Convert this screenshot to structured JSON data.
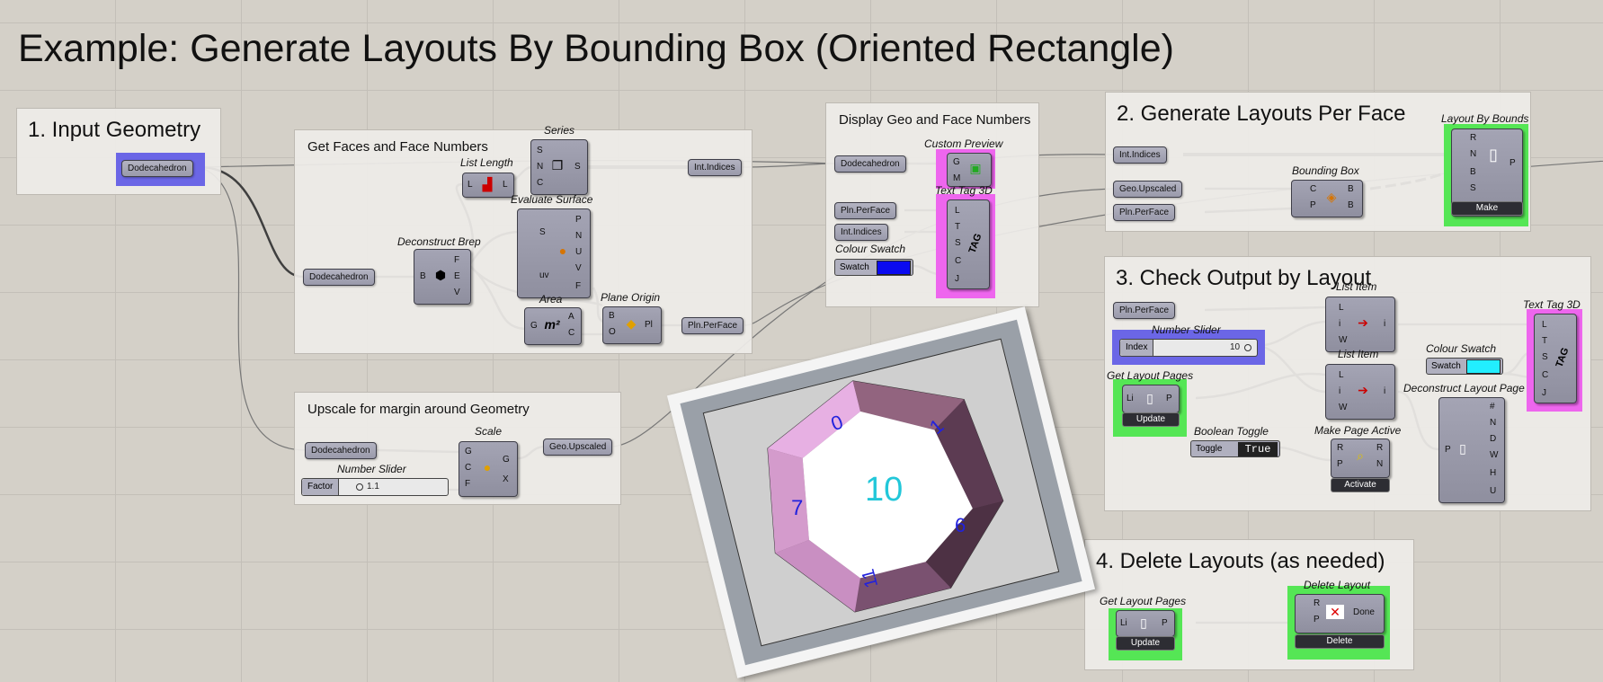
{
  "title": "Example: Generate Layouts By Bounding Box (Oriented Rectangle)",
  "groups": {
    "input": "1. Input Geometry",
    "faces": "Get Faces and Face Numbers",
    "upscale": "Upscale for margin around Geometry",
    "display": "Display Geo and Face Numbers",
    "generate": "2. Generate Layouts Per Face",
    "check": "3. Check Output by Layout",
    "delete": "4. Delete Layouts (as needed)"
  },
  "params": {
    "dodeca_input": "Dodecahedron",
    "dodeca_faces": "Dodecahedron",
    "dodeca_scale": "Dodecahedron",
    "dodeca_display": "Dodecahedron",
    "int_indices_out": "Int.Indices",
    "pln_perface_out": "Pln.PerFace",
    "geo_upscaled_out": "Geo.Upscaled",
    "pln_perface_display": "Pln.PerFace",
    "int_indices_display": "Int.Indices",
    "int_indices_gen": "Int.Indices",
    "geo_upscaled_gen": "Geo.Upscaled",
    "pln_perface_gen": "Pln.PerFace",
    "pln_perface_check": "Pln.PerFace"
  },
  "components": {
    "series": {
      "caption": "Series",
      "in": [
        "S",
        "N",
        "C"
      ],
      "out": [
        "S"
      ]
    },
    "list_length": {
      "caption": "List Length",
      "in": [
        "L"
      ],
      "out": [
        "L"
      ]
    },
    "evaluate_surface": {
      "caption": "Evaluate Surface",
      "in": [
        "S",
        "uv"
      ],
      "out": [
        "P",
        "N",
        "U",
        "V",
        "F"
      ]
    },
    "deconstruct_brep": {
      "caption": "Deconstruct Brep",
      "in": [
        "B"
      ],
      "out": [
        "F",
        "E",
        "V"
      ]
    },
    "area": {
      "caption": "Area",
      "in": [
        "G"
      ],
      "out": [
        "A",
        "C"
      ],
      "glyph": "m²"
    },
    "plane_origin": {
      "caption": "Plane Origin",
      "in": [
        "B",
        "O"
      ],
      "out": [
        "Pl"
      ]
    },
    "scale": {
      "caption": "Scale",
      "in": [
        "G",
        "C",
        "F"
      ],
      "out": [
        "G",
        "X"
      ]
    },
    "custom_preview": {
      "caption": "Custom Preview",
      "in": [
        "G",
        "M"
      ]
    },
    "text_tag_3d": {
      "caption": "Text Tag 3D",
      "in": [
        "L",
        "T",
        "S",
        "C",
        "J"
      ],
      "glyph": "TAG"
    },
    "bounding_box": {
      "caption": "Bounding Box",
      "in": [
        "C",
        "P"
      ],
      "out": [
        "B",
        "B"
      ]
    },
    "layout_by_bounds": {
      "caption": "Layout By Bounds",
      "in": [
        "R",
        "N",
        "B",
        "S"
      ],
      "out": [
        "P"
      ],
      "button": "Make"
    },
    "list_item_1": {
      "caption": "List Item",
      "in": [
        "L",
        "i",
        "W"
      ],
      "out": [
        "i"
      ]
    },
    "list_item_2": {
      "caption": "List Item",
      "in": [
        "L",
        "i",
        "W"
      ],
      "out": [
        "i"
      ]
    },
    "get_layout_pages_1": {
      "caption": "Get Layout Pages",
      "in": [
        "Li"
      ],
      "out": [
        "P"
      ],
      "button": "Update"
    },
    "get_layout_pages_2": {
      "caption": "Get Layout Pages",
      "in": [
        "Li"
      ],
      "out": [
        "P"
      ],
      "button": "Update"
    },
    "make_page_active": {
      "caption": "Make Page Active",
      "in": [
        "R",
        "P"
      ],
      "out": [
        "R",
        "N"
      ],
      "button": "Activate"
    },
    "deconstruct_layout_page": {
      "caption": "Deconstruct Layout Page",
      "in": [
        "P"
      ],
      "out": [
        "#",
        "N",
        "D",
        "W",
        "H",
        "U"
      ]
    },
    "text_tag_3d_2": {
      "caption": "Text Tag 3D",
      "in": [
        "L",
        "T",
        "S",
        "C",
        "J"
      ],
      "glyph": "TAG"
    },
    "delete_layout": {
      "caption": "Delete Layout",
      "in": [
        "R",
        "P"
      ],
      "out": [
        "Done"
      ],
      "button": "Delete"
    }
  },
  "sliders": {
    "factor": {
      "caption": "Number Slider",
      "label": "Factor",
      "value": "1.1"
    },
    "index": {
      "caption": "Number Slider",
      "label": "Index",
      "value": "10"
    }
  },
  "swatches": {
    "swatch_1": {
      "caption": "Colour Swatch",
      "label": "Swatch",
      "color": "#0a0af0"
    },
    "swatch_2": {
      "caption": "Colour Swatch",
      "label": "Swatch",
      "color": "#22eeff"
    }
  },
  "toggle": {
    "caption": "Boolean Toggle",
    "label": "Toggle",
    "value": "True"
  },
  "viewport": {
    "face_numbers": [
      "0",
      "1",
      "7",
      "6",
      "11"
    ],
    "center_number": "10"
  }
}
